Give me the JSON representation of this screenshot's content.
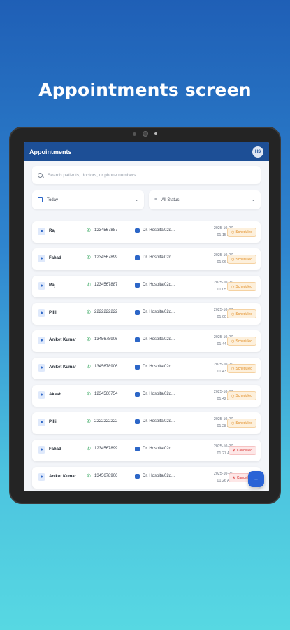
{
  "headline": "Appointments screen",
  "app": {
    "title": "Appointments",
    "avatar_initials": "HS"
  },
  "search": {
    "placeholder": "Search patients, doctors, or phone numbers..."
  },
  "filters": {
    "date": "Today",
    "status": "All Status"
  },
  "colors": {
    "header": "#1d4f96",
    "accent": "#2a63d6",
    "scheduled": "#e08a1f",
    "cancelled": "#d93a3a"
  },
  "appointments": [
    {
      "patient": "Raj",
      "phone": "1234567887",
      "doctor": "Dr. Hospital02d...",
      "date": "2025-10-27",
      "time": "01:15 AM",
      "status": "Scheduled"
    },
    {
      "patient": "Fahad",
      "phone": "1234567899",
      "doctor": "Dr. Hospital02d...",
      "date": "2025-10-27",
      "time": "01:06 AM",
      "status": "Scheduled"
    },
    {
      "patient": "Raj",
      "phone": "1234567887",
      "doctor": "Dr. Hospital02d...",
      "date": "2025-10-27",
      "time": "01:05 AM",
      "status": "Scheduled"
    },
    {
      "patient": "Pilli",
      "phone": "2222222222",
      "doctor": "Dr. Hospital02d...",
      "date": "2025-10-27",
      "time": "01:00 AM",
      "status": "Scheduled"
    },
    {
      "patient": "Aniket Kumar",
      "phone": "1345678906",
      "doctor": "Dr. Hospital02d...",
      "date": "2025-10-27",
      "time": "01:44 AM",
      "status": "Scheduled"
    },
    {
      "patient": "Aniket Kumar",
      "phone": "1345678906",
      "doctor": "Dr. Hospital02d...",
      "date": "2025-10-27",
      "time": "01:43 AM",
      "status": "Scheduled"
    },
    {
      "patient": "Akash",
      "phone": "1234560754",
      "doctor": "Dr. Hospital02d...",
      "date": "2025-10-27",
      "time": "01:42 AM",
      "status": "Scheduled"
    },
    {
      "patient": "Pilli",
      "phone": "2222222222",
      "doctor": "Dr. Hospital02d...",
      "date": "2025-10-27",
      "time": "01:28 AM",
      "status": "Scheduled"
    },
    {
      "patient": "Fahad",
      "phone": "1234567899",
      "doctor": "Dr. Hospital02d...",
      "date": "2025-10-27",
      "time": "01:27 AM",
      "status": "Cancelled"
    },
    {
      "patient": "Aniket Kumar",
      "phone": "1345678906",
      "doctor": "Dr. Hospital02d...",
      "date": "2025-10-27",
      "time": "01:26 AM",
      "status": "Cancelled"
    }
  ],
  "fab": {
    "icon": "plus-icon"
  }
}
